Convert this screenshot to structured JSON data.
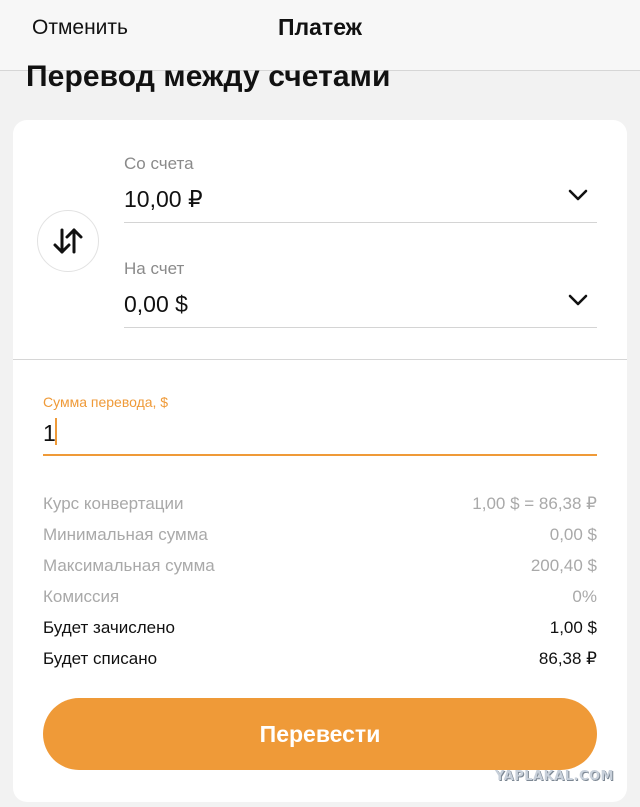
{
  "navbar": {
    "cancel_label": "Отменить",
    "title": "Платеж"
  },
  "page": {
    "title": "Перевод между счетами"
  },
  "from_account": {
    "label": "Со счета",
    "value": "10,00 ₽",
    "icon": "chevron-down-icon"
  },
  "to_account": {
    "label": "На счет",
    "value": "0,00 $",
    "icon": "chevron-down-icon"
  },
  "swap": {
    "icon": "swap-arrows-icon"
  },
  "amount": {
    "label": "Сумма перевода, $",
    "value": "1"
  },
  "details": [
    {
      "label": "Курс конвертации",
      "value": "1,00 $ = 86,38 ₽"
    },
    {
      "label": "Минимальная сумма",
      "value": "0,00 $"
    },
    {
      "label": "Максимальная сумма",
      "value": "200,40 $"
    },
    {
      "label": "Комиссия",
      "value": "0%"
    },
    {
      "label": "Будет зачислено",
      "value": "1,00 $"
    },
    {
      "label": "Будет списано",
      "value": "86,38 ₽"
    }
  ],
  "submit": {
    "label": "Перевести"
  },
  "watermark": "YAPLAKAL.COM",
  "colors": {
    "accent": "#ef9a38",
    "muted_text": "#a9a9a9",
    "background": "#f2f2f2"
  }
}
